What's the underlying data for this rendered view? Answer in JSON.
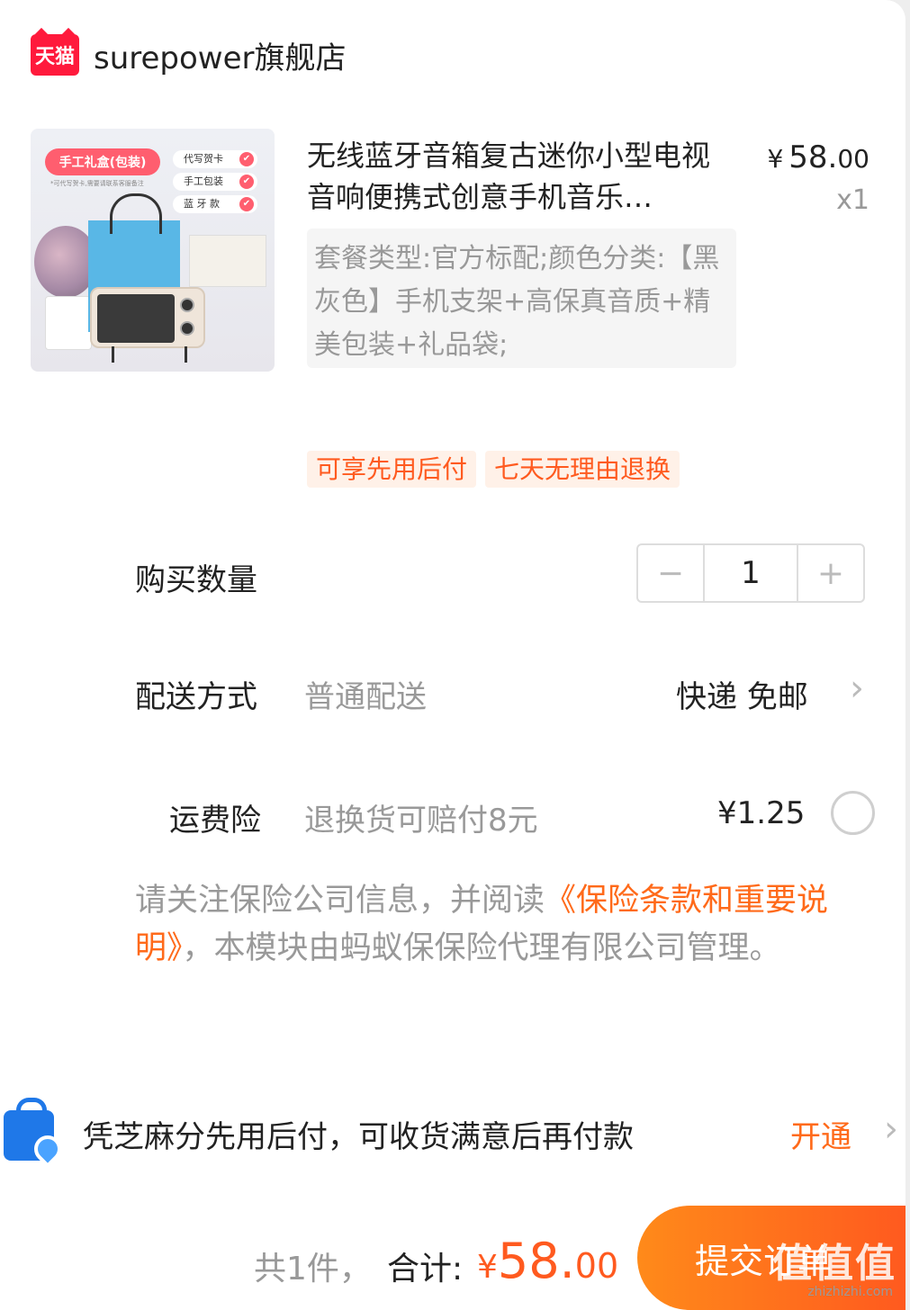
{
  "store": {
    "logo_text": "天猫",
    "name": "surepower旗舰店"
  },
  "product": {
    "image_texts": {
      "badge": "手工礼盒(包装)",
      "note": "*可代写贺卡,需要请联系客服备注",
      "options": [
        "代写贺卡",
        "手工包装",
        "蓝 牙 款"
      ]
    },
    "title": "无线蓝牙音箱复古迷你小型电视音响便携式创意手机音乐…",
    "price_yen": "¥",
    "price_int": "58.",
    "price_cents": "00",
    "quantity_label": "x1",
    "sku": "套餐类型:官方标配;颜色分类:【黑灰色】手机支架+高保真音质+精美包装+礼品袋;",
    "tags": [
      "可享先用后付",
      "七天无理由退换"
    ]
  },
  "quantity": {
    "label": "购买数量",
    "minus": "−",
    "value": "1",
    "plus": "+"
  },
  "delivery": {
    "label": "配送方式",
    "method": "普通配送",
    "value": "快递 免邮",
    "chevron": "›"
  },
  "insurance": {
    "label": "运费险",
    "desc": "退换货可赔付8元",
    "price": "¥1.25",
    "selected": false
  },
  "notice": {
    "prefix": "请关注保险公司信息，并阅读",
    "link": "《保险条款和重要说明》",
    "suffix": "，本模块由蚂蚁保保险代理有限公司管理。"
  },
  "pay_later": {
    "icon": "alipay-bag-icon",
    "text": "凭芝麻分先用后付，可收货满意后再付款",
    "action": "开通",
    "chevron": "›"
  },
  "footer": {
    "count": "共1件，",
    "total_label": "合计:",
    "total_yen": "¥",
    "total_int": "58.",
    "total_cents": "00",
    "submit_label": "提交订单"
  },
  "watermark": {
    "main": "值值值",
    "sub": "zhizhizhi.com"
  },
  "colors": {
    "accent": "#ff5a1f",
    "tag_bg": "#fff1e8",
    "link": "#ff6a1a",
    "tmall_red": "#ff1a3c",
    "alipay_blue": "#1f78e8"
  }
}
